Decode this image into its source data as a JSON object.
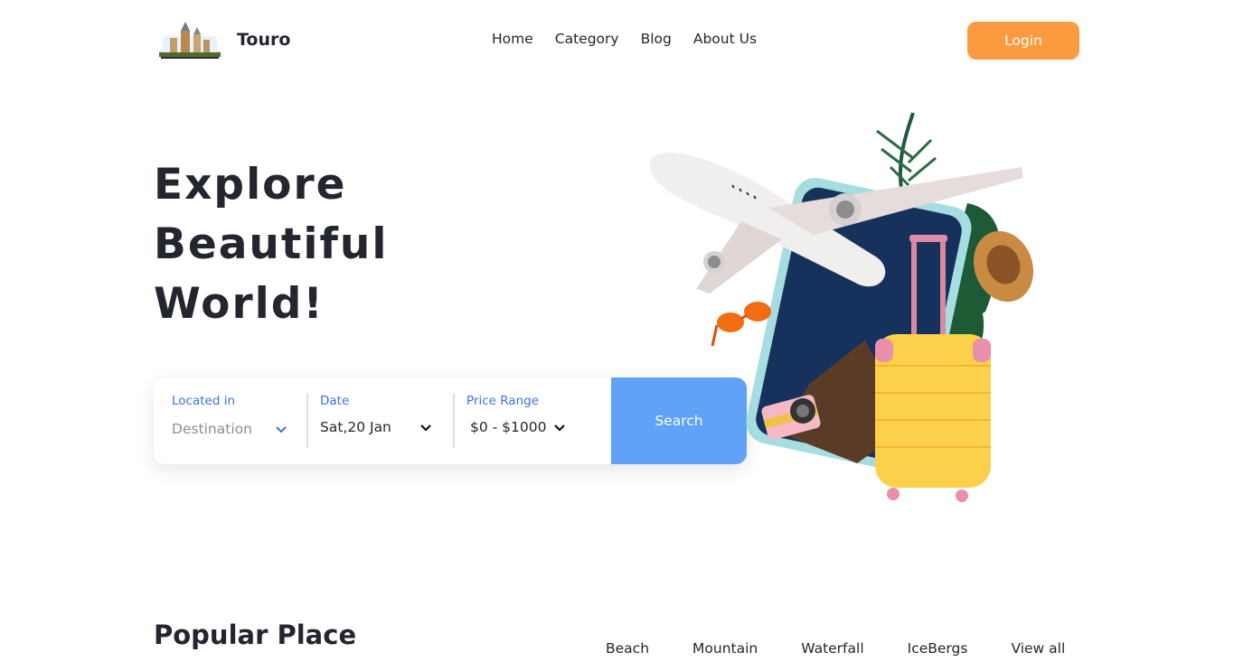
{
  "header": {
    "brand": "Touro",
    "nav": [
      "Home",
      "Category",
      "Blog",
      "About Us"
    ],
    "login_label": "Login"
  },
  "hero": {
    "title_lines": [
      "Explore",
      "Beautiful",
      "World!"
    ]
  },
  "search": {
    "location_label": "Located in",
    "location_value": "Destination",
    "date_label": "Date",
    "date_value": "Sat,20 Jan",
    "price_label": "Price Range",
    "price_value": "$0 - $1000",
    "button_label": "Search"
  },
  "popular": {
    "title": "Popular Place",
    "filters": [
      "Beach",
      "Mountain",
      "Waterfall",
      "IceBergs",
      "View all"
    ]
  },
  "colors": {
    "accent_orange": "#fc9a3f",
    "accent_blue": "#5fa2f8",
    "label_blue": "#3b71e3",
    "text_dark": "#23262f"
  }
}
